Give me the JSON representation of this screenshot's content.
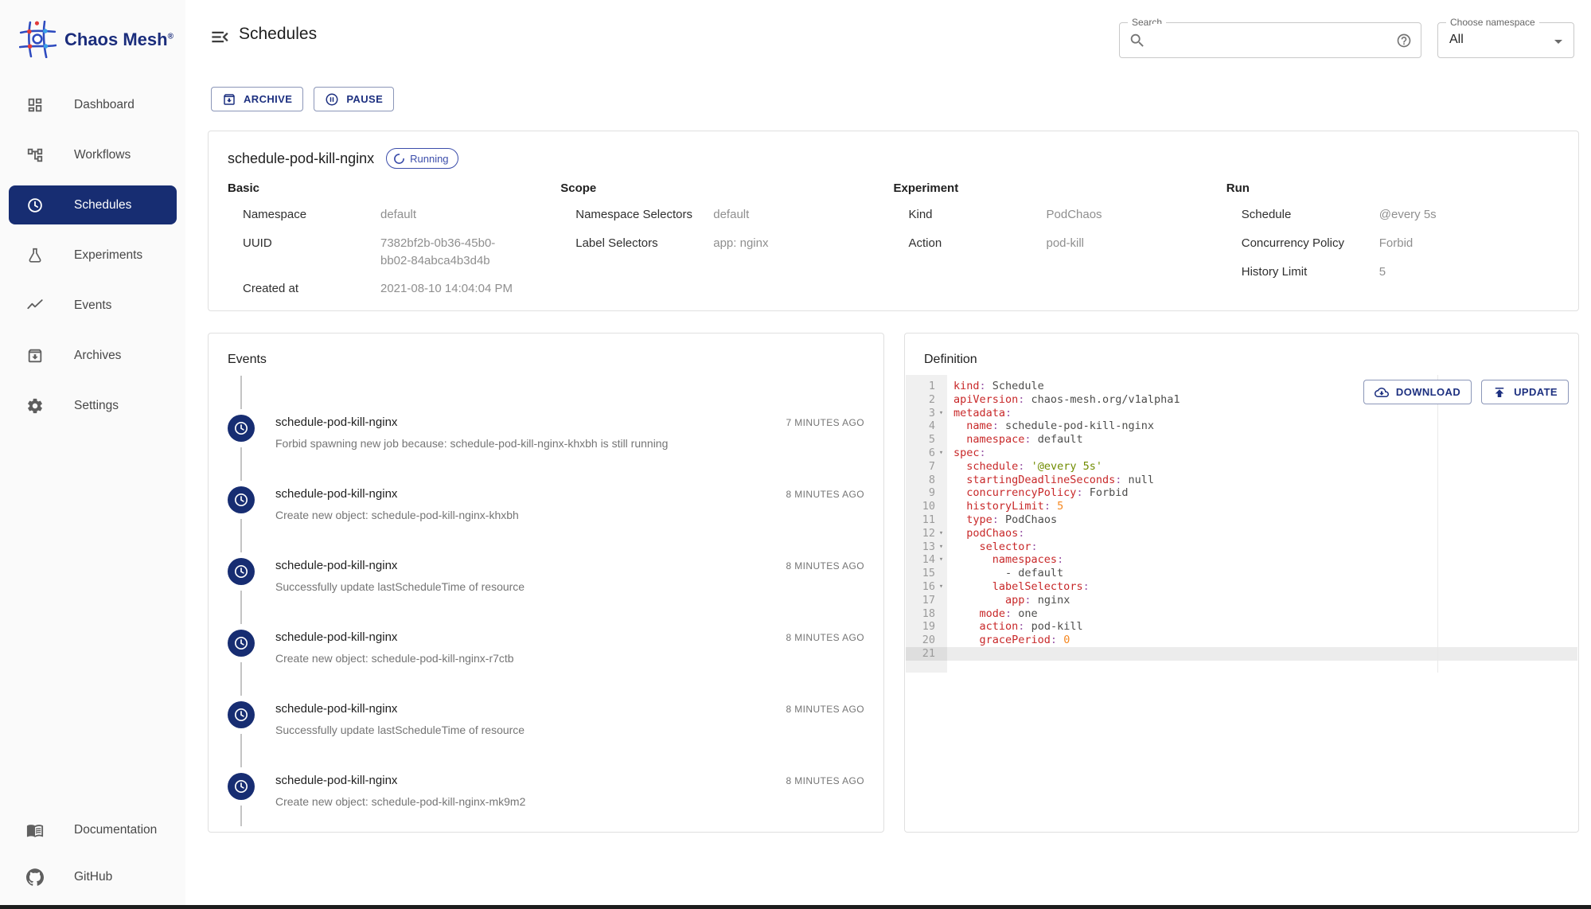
{
  "brand": {
    "name": "Chaos Mesh",
    "trademark": "®"
  },
  "sidebar": {
    "items": [
      {
        "label": "Dashboard",
        "icon": "dashboard-icon",
        "selected": false
      },
      {
        "label": "Workflows",
        "icon": "workflows-icon",
        "selected": false
      },
      {
        "label": "Schedules",
        "icon": "clock-icon",
        "selected": true
      },
      {
        "label": "Experiments",
        "icon": "flask-icon",
        "selected": false
      },
      {
        "label": "Events",
        "icon": "events-icon",
        "selected": false
      },
      {
        "label": "Archives",
        "icon": "archive-box-icon",
        "selected": false
      },
      {
        "label": "Settings",
        "icon": "gear-icon",
        "selected": false
      }
    ],
    "footer_items": [
      {
        "label": "Documentation",
        "icon": "book-icon"
      },
      {
        "label": "GitHub",
        "icon": "github-icon"
      }
    ]
  },
  "header": {
    "menu_icon": "menu-open-icon",
    "title": "Schedules",
    "search": {
      "label": "Search",
      "value": "",
      "icon": "search-icon",
      "help_icon": "help-icon"
    },
    "namespace": {
      "label": "Choose namespace",
      "value": "All",
      "caret_icon": "caret-down-icon"
    }
  },
  "toolbar": {
    "archive_label": "ARCHIVE",
    "archive_icon": "archive-box-icon",
    "pause_label": "PAUSE",
    "pause_icon": "pause-circle-icon"
  },
  "schedule": {
    "name": "schedule-pod-kill-nginx",
    "status": "Running",
    "status_icon": "spinner-icon",
    "sections": [
      {
        "title": "Basic",
        "rows": [
          {
            "label": "Namespace",
            "value": "default"
          },
          {
            "label": "UUID",
            "value": "7382bf2b-0b36-45b0-bb02-84abca4b3d4b"
          },
          {
            "label": "Created at",
            "value": "2021-08-10 14:04:04 PM"
          }
        ]
      },
      {
        "title": "Scope",
        "rows": [
          {
            "label": "Namespace Selectors",
            "value": "default"
          },
          {
            "label": "Label Selectors",
            "value": "app: nginx"
          }
        ]
      },
      {
        "title": "Experiment",
        "rows": [
          {
            "label": "Kind",
            "value": "PodChaos"
          },
          {
            "label": "Action",
            "value": "pod-kill"
          }
        ]
      },
      {
        "title": "Run",
        "rows": [
          {
            "label": "Schedule",
            "value": "@every 5s"
          },
          {
            "label": "Concurrency Policy",
            "value": "Forbid"
          },
          {
            "label": "History Limit",
            "value": "5"
          }
        ]
      }
    ]
  },
  "events": {
    "title": "Events",
    "item_icon": "clock-icon",
    "items": [
      {
        "name": "schedule-pod-kill-nginx",
        "message": "Forbid spawning new job because: schedule-pod-kill-nginx-khxbh is still running",
        "time": "7 MINUTES AGO"
      },
      {
        "name": "schedule-pod-kill-nginx",
        "message": "Create new object: schedule-pod-kill-nginx-khxbh",
        "time": "8 MINUTES AGO"
      },
      {
        "name": "schedule-pod-kill-nginx",
        "message": "Successfully update lastScheduleTime of resource",
        "time": "8 MINUTES AGO"
      },
      {
        "name": "schedule-pod-kill-nginx",
        "message": "Create new object: schedule-pod-kill-nginx-r7ctb",
        "time": "8 MINUTES AGO"
      },
      {
        "name": "schedule-pod-kill-nginx",
        "message": "Successfully update lastScheduleTime of resource",
        "time": "8 MINUTES AGO"
      },
      {
        "name": "schedule-pod-kill-nginx",
        "message": "Create new object: schedule-pod-kill-nginx-mk9m2",
        "time": "8 MINUTES AGO"
      }
    ]
  },
  "definition": {
    "title": "Definition",
    "download_label": "DOWNLOAD",
    "download_icon": "cloud-download-icon",
    "update_label": "UPDATE",
    "update_icon": "publish-icon",
    "fold_marker": "▾",
    "code_lines": [
      {
        "num": "1",
        "fold": false,
        "active": false,
        "tokens": [
          [
            "k",
            "kind"
          ],
          [
            "c",
            ":"
          ],
          [
            "t",
            " Schedule"
          ]
        ]
      },
      {
        "num": "2",
        "fold": false,
        "active": false,
        "tokens": [
          [
            "k",
            "apiVersion"
          ],
          [
            "c",
            ":"
          ],
          [
            "t",
            " chaos-mesh.org/v1alpha1"
          ]
        ]
      },
      {
        "num": "3",
        "fold": true,
        "active": false,
        "tokens": [
          [
            "k",
            "metadata"
          ],
          [
            "c",
            ":"
          ]
        ]
      },
      {
        "num": "4",
        "fold": false,
        "active": false,
        "tokens": [
          [
            "t",
            "  "
          ],
          [
            "k",
            "name"
          ],
          [
            "c",
            ":"
          ],
          [
            "t",
            " schedule-pod-kill-nginx"
          ]
        ]
      },
      {
        "num": "5",
        "fold": false,
        "active": false,
        "tokens": [
          [
            "t",
            "  "
          ],
          [
            "k",
            "namespace"
          ],
          [
            "c",
            ":"
          ],
          [
            "t",
            " default"
          ]
        ]
      },
      {
        "num": "6",
        "fold": true,
        "active": false,
        "tokens": [
          [
            "k",
            "spec"
          ],
          [
            "c",
            ":"
          ]
        ]
      },
      {
        "num": "7",
        "fold": false,
        "active": false,
        "tokens": [
          [
            "t",
            "  "
          ],
          [
            "k",
            "schedule"
          ],
          [
            "c",
            ":"
          ],
          [
            "s",
            " '@every 5s'"
          ]
        ]
      },
      {
        "num": "8",
        "fold": false,
        "active": false,
        "tokens": [
          [
            "t",
            "  "
          ],
          [
            "k",
            "startingDeadlineSeconds"
          ],
          [
            "c",
            ":"
          ],
          [
            "t",
            " null"
          ]
        ]
      },
      {
        "num": "9",
        "fold": false,
        "active": false,
        "tokens": [
          [
            "t",
            "  "
          ],
          [
            "k",
            "concurrencyPolicy"
          ],
          [
            "c",
            ":"
          ],
          [
            "t",
            " Forbid"
          ]
        ]
      },
      {
        "num": "10",
        "fold": false,
        "active": false,
        "tokens": [
          [
            "t",
            "  "
          ],
          [
            "k",
            "historyLimit"
          ],
          [
            "c",
            ":"
          ],
          [
            "n",
            " 5"
          ]
        ]
      },
      {
        "num": "11",
        "fold": false,
        "active": false,
        "tokens": [
          [
            "t",
            "  "
          ],
          [
            "k",
            "type"
          ],
          [
            "c",
            ":"
          ],
          [
            "t",
            " PodChaos"
          ]
        ]
      },
      {
        "num": "12",
        "fold": true,
        "active": false,
        "tokens": [
          [
            "t",
            "  "
          ],
          [
            "k",
            "podChaos"
          ],
          [
            "c",
            ":"
          ]
        ]
      },
      {
        "num": "13",
        "fold": true,
        "active": false,
        "tokens": [
          [
            "t",
            "    "
          ],
          [
            "k",
            "selector"
          ],
          [
            "c",
            ":"
          ]
        ]
      },
      {
        "num": "14",
        "fold": true,
        "active": false,
        "tokens": [
          [
            "t",
            "      "
          ],
          [
            "k",
            "namespaces"
          ],
          [
            "c",
            ":"
          ]
        ]
      },
      {
        "num": "15",
        "fold": false,
        "active": false,
        "tokens": [
          [
            "t",
            "        - default"
          ]
        ]
      },
      {
        "num": "16",
        "fold": true,
        "active": false,
        "tokens": [
          [
            "t",
            "      "
          ],
          [
            "k",
            "labelSelectors"
          ],
          [
            "c",
            ":"
          ]
        ]
      },
      {
        "num": "17",
        "fold": false,
        "active": false,
        "tokens": [
          [
            "t",
            "        "
          ],
          [
            "k",
            "app"
          ],
          [
            "c",
            ":"
          ],
          [
            "t",
            " nginx"
          ]
        ]
      },
      {
        "num": "18",
        "fold": false,
        "active": false,
        "tokens": [
          [
            "t",
            "    "
          ],
          [
            "k",
            "mode"
          ],
          [
            "c",
            ":"
          ],
          [
            "t",
            " one"
          ]
        ]
      },
      {
        "num": "19",
        "fold": false,
        "active": false,
        "tokens": [
          [
            "t",
            "    "
          ],
          [
            "k",
            "action"
          ],
          [
            "c",
            ":"
          ],
          [
            "t",
            " pod-kill"
          ]
        ]
      },
      {
        "num": "20",
        "fold": false,
        "active": false,
        "tokens": [
          [
            "t",
            "    "
          ],
          [
            "k",
            "gracePeriod"
          ],
          [
            "c",
            ":"
          ],
          [
            "n",
            " 0"
          ]
        ]
      },
      {
        "num": "21",
        "fold": false,
        "active": true,
        "tokens": []
      }
    ]
  },
  "colors": {
    "primary": "#172d72",
    "status_running": "#3b4daa",
    "code_key": "#c82829",
    "code_string": "#718c00",
    "code_number": "#f5871f",
    "code_punct": "#9b59a8"
  }
}
